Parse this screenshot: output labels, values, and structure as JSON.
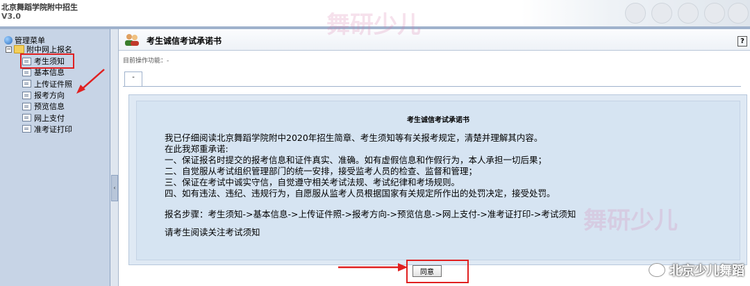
{
  "app": {
    "title": "北京舞蹈学院附中招生",
    "version": "V3.0"
  },
  "sidebar": {
    "root_label": "管理菜单",
    "group_label": "附中网上报名",
    "items": [
      {
        "label": "考生须知"
      },
      {
        "label": "基本信息"
      },
      {
        "label": "上传证件照"
      },
      {
        "label": "报考方向"
      },
      {
        "label": "预览信息"
      },
      {
        "label": "网上支付"
      },
      {
        "label": "准考证打印"
      }
    ],
    "active_index": 0
  },
  "panel": {
    "title": "考生诚信考试承诺书",
    "help_glyph": "?",
    "func_label": "目前操作功能：-",
    "tab_label": "-"
  },
  "pledge": {
    "heading": "考生诚信考试承诺书",
    "lines": [
      "我已仔细阅读北京舞蹈学院附中2020年招生简章、考生须知等有关报考规定，清楚并理解其内容。",
      "在此我郑重承诺:",
      "一、保证报名时提交的报考信息和证件真实、准确。如有虚假信息和作假行为，本人承担一切后果；",
      "二、自觉服从考试组织管理部门的统一安排，接受监考人员的检查、监督和管理；",
      "三、保证在考试中诚实守信，自觉遵守相关考试法规、考试纪律和考场规则。",
      "四、如有违法、违纪、违规行为，自愿服从监考人员根据国家有关规定所作出的处罚决定，接受处罚。"
    ],
    "steps": "报名步骤：考生须知->基本信息->上传证件照->报考方向->预览信息->网上支付->准考证打印->考试须知",
    "notice": "请考生阅读关注考试须知"
  },
  "buttons": {
    "agree_label": "同意"
  },
  "watermark": {
    "text": "北京少儿舞蹈",
    "ghost": "舞研少儿"
  },
  "colors": {
    "highlight": "#e02020",
    "sidebar_bg": "#c7d4e6",
    "pledge_bg": "#d6e4f2"
  }
}
